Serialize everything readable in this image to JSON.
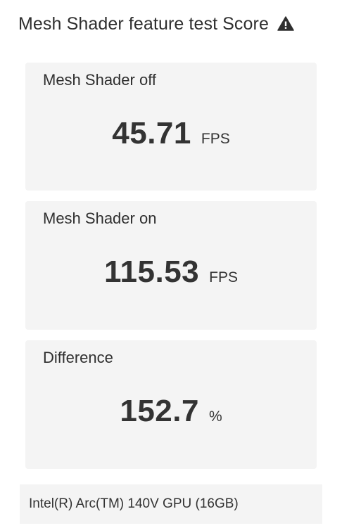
{
  "header": {
    "title": "Mesh Shader feature test Score",
    "warning_icon": "warning-triangle-icon"
  },
  "cards": [
    {
      "label": "Mesh Shader off",
      "value": "45.71",
      "unit": "FPS"
    },
    {
      "label": "Mesh Shader on",
      "value": "115.53",
      "unit": "FPS"
    },
    {
      "label": "Difference",
      "value": "152.7",
      "unit": "%"
    }
  ],
  "gpu": {
    "name": "Intel(R) Arc(TM) 140V GPU (16GB)"
  },
  "colors": {
    "card_background": "#f4f4f4",
    "text": "#2f2f2f"
  }
}
